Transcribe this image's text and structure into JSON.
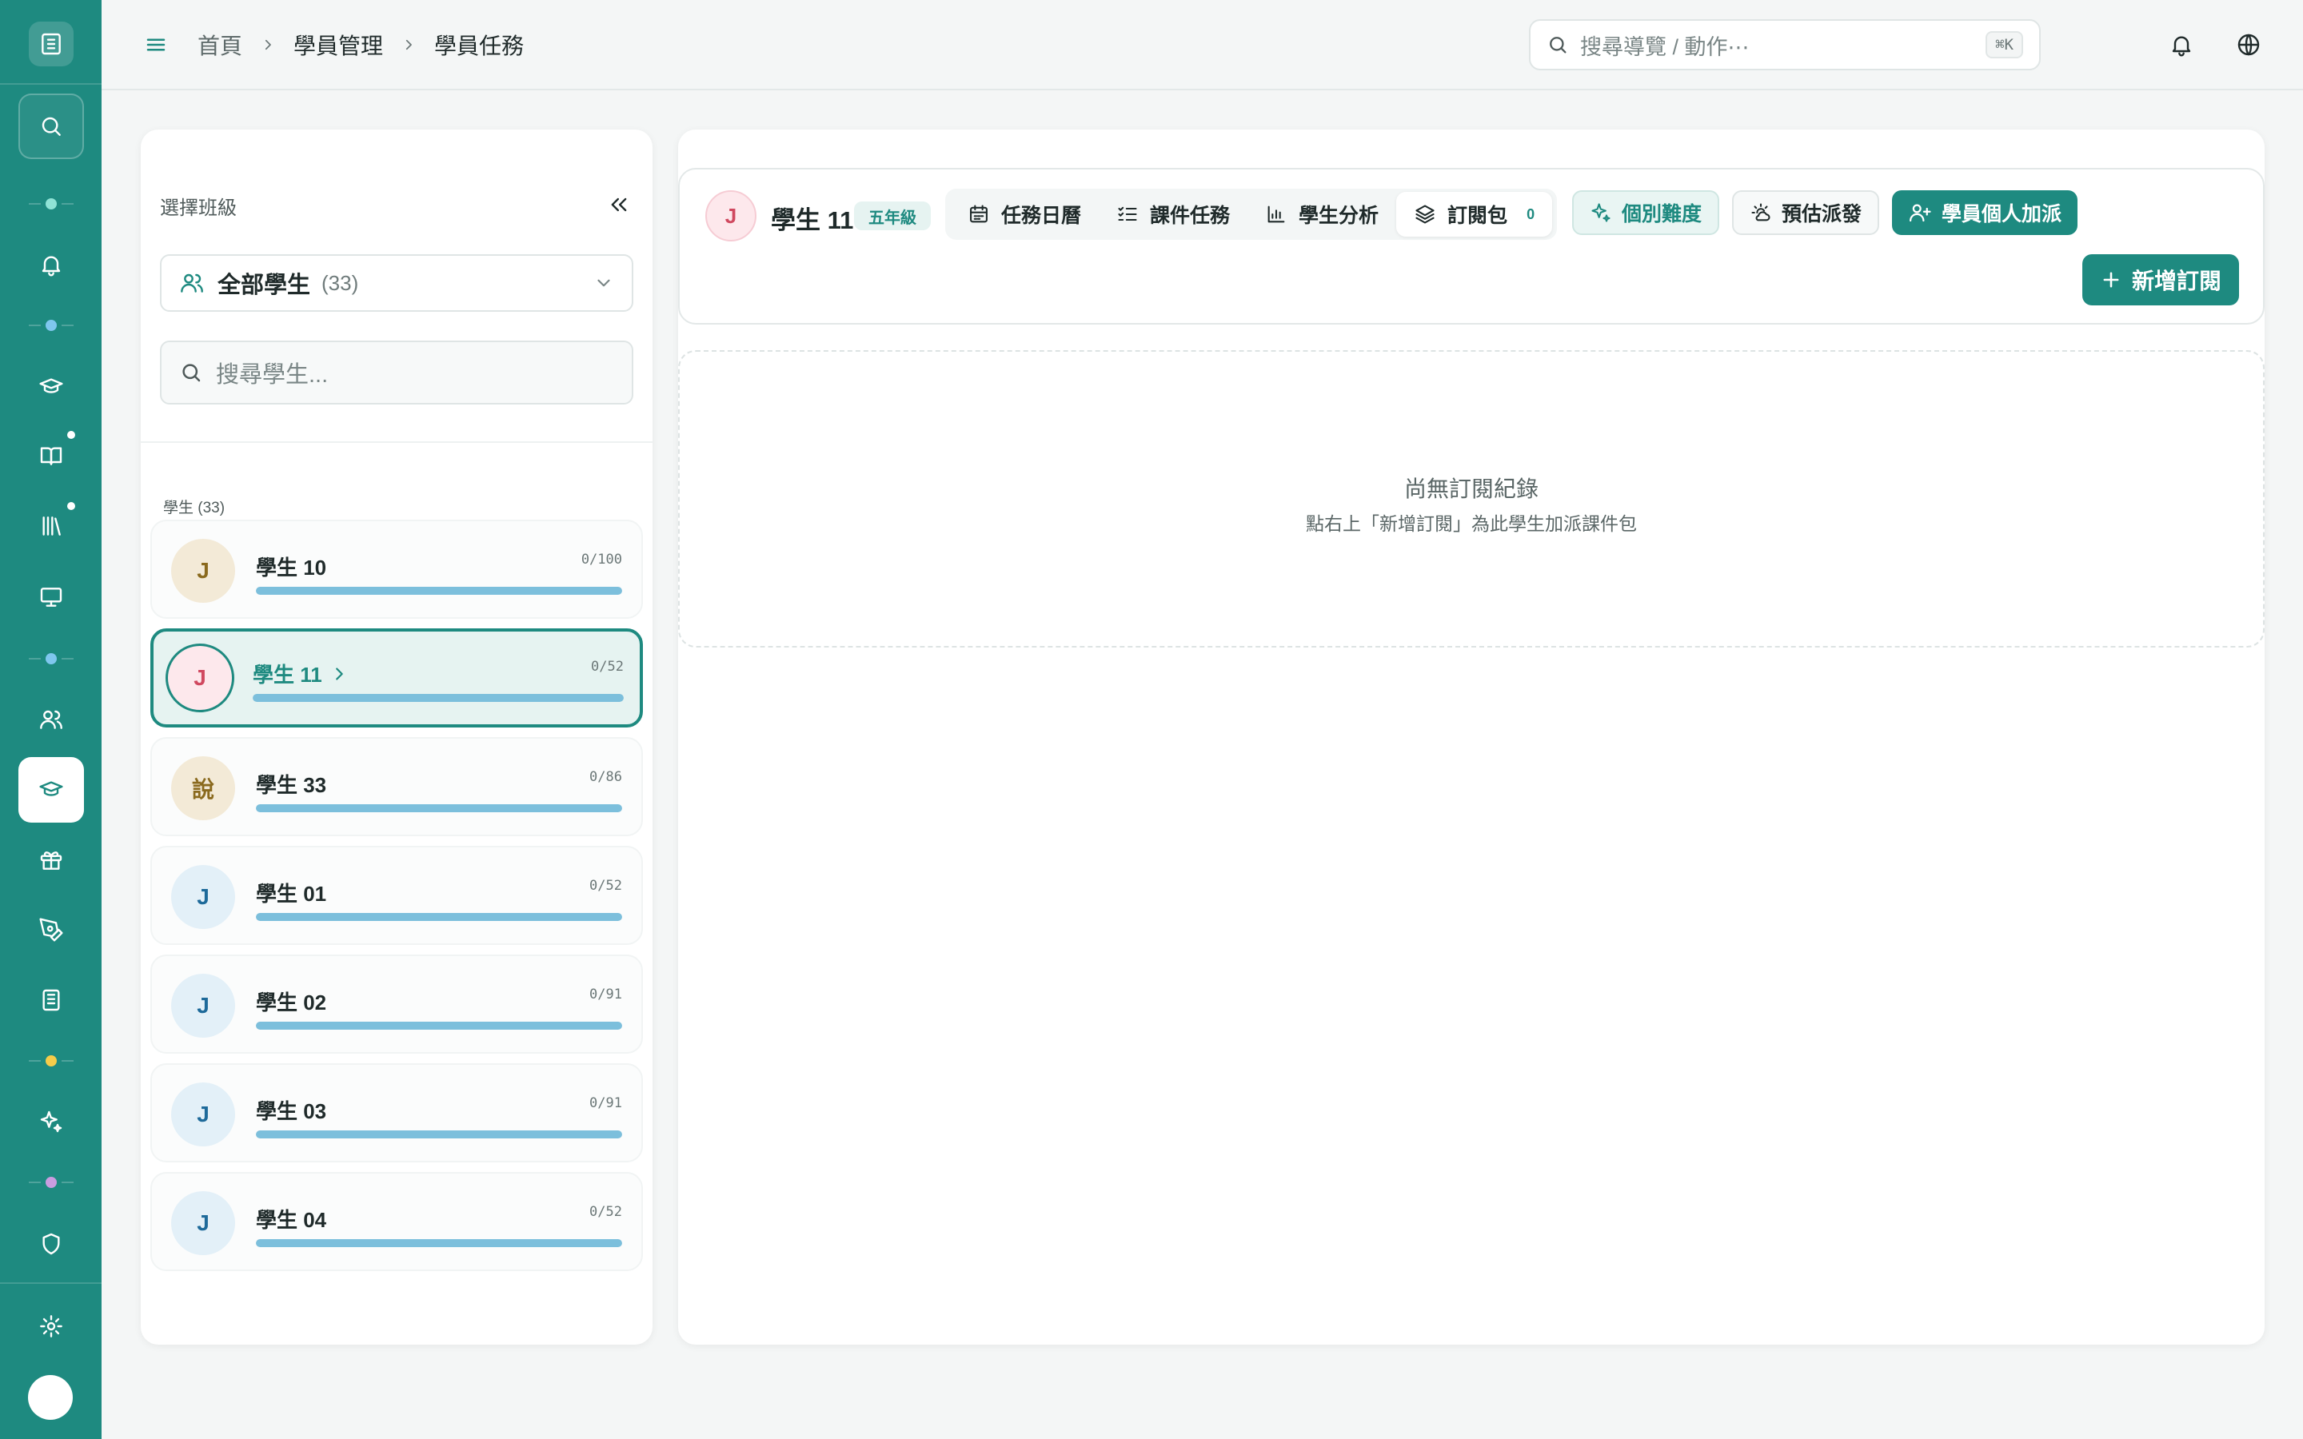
{
  "nav": {
    "items": [
      "search",
      "bell",
      "graduation-cap",
      "book",
      "library",
      "monitor",
      "users",
      "graduation-cap-active",
      "gift",
      "pen",
      "building",
      "sparkles",
      "shield",
      "gear"
    ]
  },
  "breadcrumb": [
    "首頁",
    "學員管理",
    "學員任務"
  ],
  "global_search": {
    "placeholder": "搜尋導覽 / 動作⋯",
    "shortcut": "⌘K"
  },
  "sidebar": {
    "title": "選擇班級",
    "class_select": {
      "label": "全部學生",
      "count": "(33)"
    },
    "search_placeholder": "搜尋學生...",
    "list_header": "學生 (33)",
    "students": [
      {
        "avatar": "J",
        "name": "學生 10",
        "score": "0/100",
        "progress": 1.0,
        "avatar_bg": "#f3ead7",
        "avatar_fg": "#8a6a1e"
      },
      {
        "avatar": "J",
        "name": "學生 11",
        "score": "0/52",
        "progress": 1.0,
        "avatar_bg": "#fde8ec",
        "avatar_fg": "#d0485f",
        "active": true
      },
      {
        "avatar": "說",
        "name": "學生 33",
        "score": "0/86",
        "progress": 1.0,
        "avatar_bg": "#f3ead7",
        "avatar_fg": "#8a6a1e"
      },
      {
        "avatar": "J",
        "name": "學生 01",
        "score": "0/52",
        "progress": 1.0,
        "avatar_bg": "#e3f0f8",
        "avatar_fg": "#1e6a9a"
      },
      {
        "avatar": "J",
        "name": "學生 02",
        "score": "0/91",
        "progress": 1.0,
        "avatar_bg": "#e3f0f8",
        "avatar_fg": "#1e6a9a"
      },
      {
        "avatar": "J",
        "name": "學生 03",
        "score": "0/91",
        "progress": 1.0,
        "avatar_bg": "#e3f0f8",
        "avatar_fg": "#1e6a9a"
      },
      {
        "avatar": "J",
        "name": "學生 04",
        "score": "0/52",
        "progress": 1.0,
        "avatar_bg": "#e3f0f8",
        "avatar_fg": "#1e6a9a"
      }
    ]
  },
  "student_header": {
    "avatar": "J",
    "name": "學生 11",
    "grade": "五年級",
    "tabs": [
      {
        "label": "任務日曆",
        "icon": "calendar-icon"
      },
      {
        "label": "課件任務",
        "icon": "checklist-icon"
      },
      {
        "label": "學生分析",
        "icon": "bar-chart-icon"
      },
      {
        "label": "訂閱包",
        "icon": "layers-icon",
        "count": "0",
        "active": true
      }
    ],
    "actions": {
      "difficulty": "個別難度",
      "estimate": "預估派發",
      "personal_assign": "學員個人加派"
    },
    "new_subscription": "新增訂閱"
  },
  "empty_state": {
    "title": "尚無訂閱紀錄",
    "subtitle": "點右上「新增訂閱」為此學生加派課件包"
  },
  "colors": {
    "accent": "#1e8a80",
    "progress": "#7cbfdc"
  }
}
